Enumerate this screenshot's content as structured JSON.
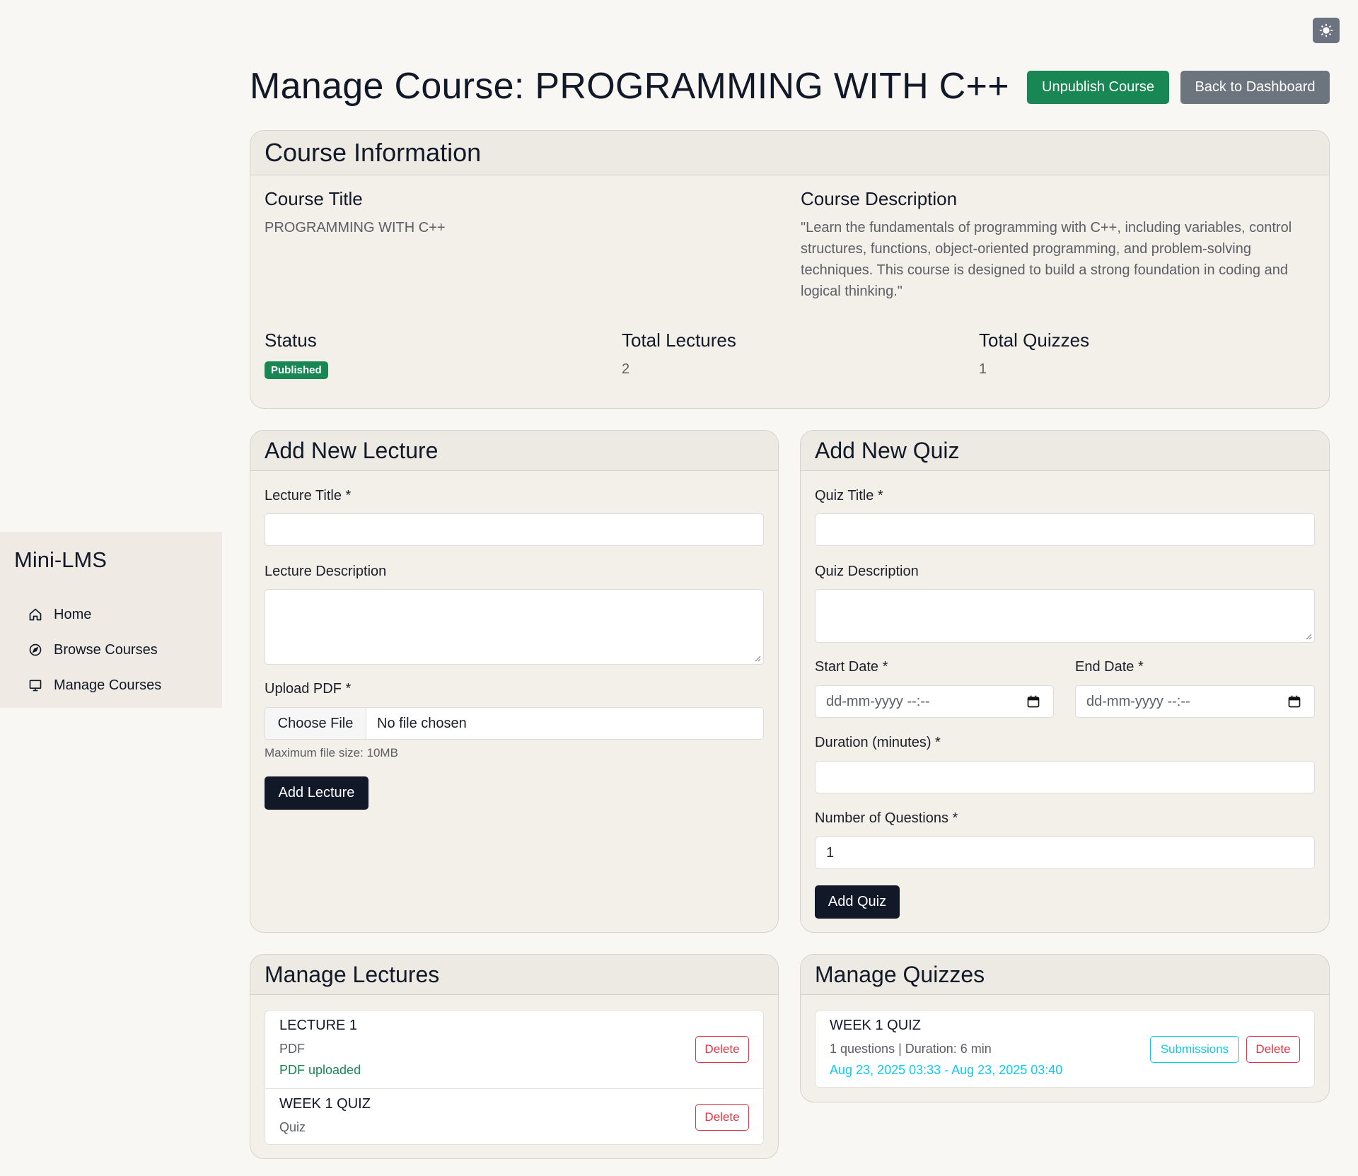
{
  "theme_toggle": {
    "icon": "sun-icon",
    "label": "☀"
  },
  "sidebar": {
    "brand": "Mini-LMS",
    "items": [
      {
        "label": "Home",
        "icon": "home-icon"
      },
      {
        "label": "Browse Courses",
        "icon": "compass-icon"
      },
      {
        "label": "Manage Courses",
        "icon": "monitor-icon"
      }
    ]
  },
  "header": {
    "title": "Manage Course: PROGRAMMING WITH C++",
    "unpublish_label": "Unpublish Course",
    "back_label": "Back to Dashboard"
  },
  "course_info": {
    "heading": "Course Information",
    "title_label": "Course Title",
    "title_value": "PROGRAMMING WITH C++",
    "description_label": "Course Description",
    "description_value": "\"Learn the fundamentals of programming with C++, including variables, control structures, functions, object-oriented programming, and problem-solving techniques. This course is designed to build a strong foundation in coding and logical thinking.\"",
    "status_label": "Status",
    "status_value": "Published",
    "lectures_label": "Total Lectures",
    "lectures_value": "2",
    "quizzes_label": "Total Quizzes",
    "quizzes_value": "1"
  },
  "add_lecture": {
    "heading": "Add New Lecture",
    "title_label": "Lecture Title *",
    "title_value": "",
    "description_label": "Lecture Description",
    "description_value": "",
    "upload_label": "Upload PDF *",
    "file_button": "Choose File",
    "file_status": "No file chosen",
    "hint": "Maximum file size: 10MB",
    "submit_label": "Add Lecture"
  },
  "add_quiz": {
    "heading": "Add New Quiz",
    "title_label": "Quiz Title *",
    "title_value": "",
    "description_label": "Quiz Description",
    "description_value": "",
    "start_label": "Start Date *",
    "start_placeholder": "dd-mm-yyyy --:--",
    "end_label": "End Date *",
    "end_placeholder": "dd-mm-yyyy --:--",
    "duration_label": "Duration (minutes) *",
    "duration_value": "",
    "questions_label": "Number of Questions *",
    "questions_value": "1",
    "submit_label": "Add Quiz"
  },
  "manage_lectures": {
    "heading": "Manage Lectures",
    "items": [
      {
        "title": "LECTURE 1",
        "type": "PDF",
        "status": "PDF uploaded",
        "delete_label": "Delete"
      },
      {
        "title": "WEEK 1 QUIZ",
        "type": "Quiz",
        "delete_label": "Delete"
      }
    ]
  },
  "manage_quizzes": {
    "heading": "Manage Quizzes",
    "items": [
      {
        "title": "WEEK 1 QUIZ",
        "meta": "1 questions | Duration: 6 min",
        "schedule": "Aug 23, 2025 03:33 - Aug 23, 2025 03:40",
        "submissions_label": "Submissions",
        "delete_label": "Delete"
      }
    ]
  },
  "colors": {
    "success": "#198754",
    "secondary": "#6c757d",
    "dark": "#111827",
    "danger": "#dc3545",
    "info": "#0dcaf0"
  }
}
